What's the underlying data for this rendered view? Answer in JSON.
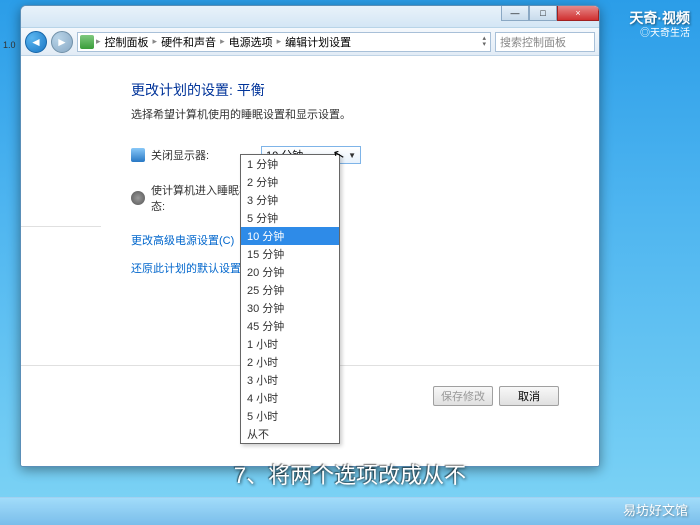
{
  "titlebar": {
    "minimize": "—",
    "maximize": "□",
    "close": "×"
  },
  "breadcrumb": {
    "items": [
      "控制面板",
      "硬件和声音",
      "电源选项",
      "编辑计划设置"
    ],
    "sep": "▸"
  },
  "nav": {
    "back": "◄",
    "forward": "►"
  },
  "search": {
    "placeholder": "搜索控制面板"
  },
  "main": {
    "heading": "更改计划的设置: 平衡",
    "subheading": "选择希望计算机使用的睡眠设置和显示设置。",
    "display_off": {
      "label": "关闭显示器:",
      "value": "10 分钟"
    },
    "sleep": {
      "label": "使计算机进入睡眠状态:",
      "value": ""
    },
    "link_advanced": "更改高级电源设置(C)",
    "link_restore": "还原此计划的默认设置(R)",
    "btn_save": "保存修改",
    "btn_cancel": "取消"
  },
  "dropdown": {
    "options": [
      "1 分钟",
      "2 分钟",
      "3 分钟",
      "5 分钟",
      "10 分钟",
      "15 分钟",
      "20 分钟",
      "25 分钟",
      "30 分钟",
      "45 分钟",
      "1 小时",
      "2 小时",
      "3 小时",
      "4 小时",
      "5 小时",
      "从不"
    ],
    "selected_index": 4
  },
  "caption": "7、将两个选项改成从不",
  "watermark": {
    "top": "天奇·视频",
    "top2": "◎天奇生活",
    "bottom": "易坊好文馆"
  },
  "side": "1.0"
}
